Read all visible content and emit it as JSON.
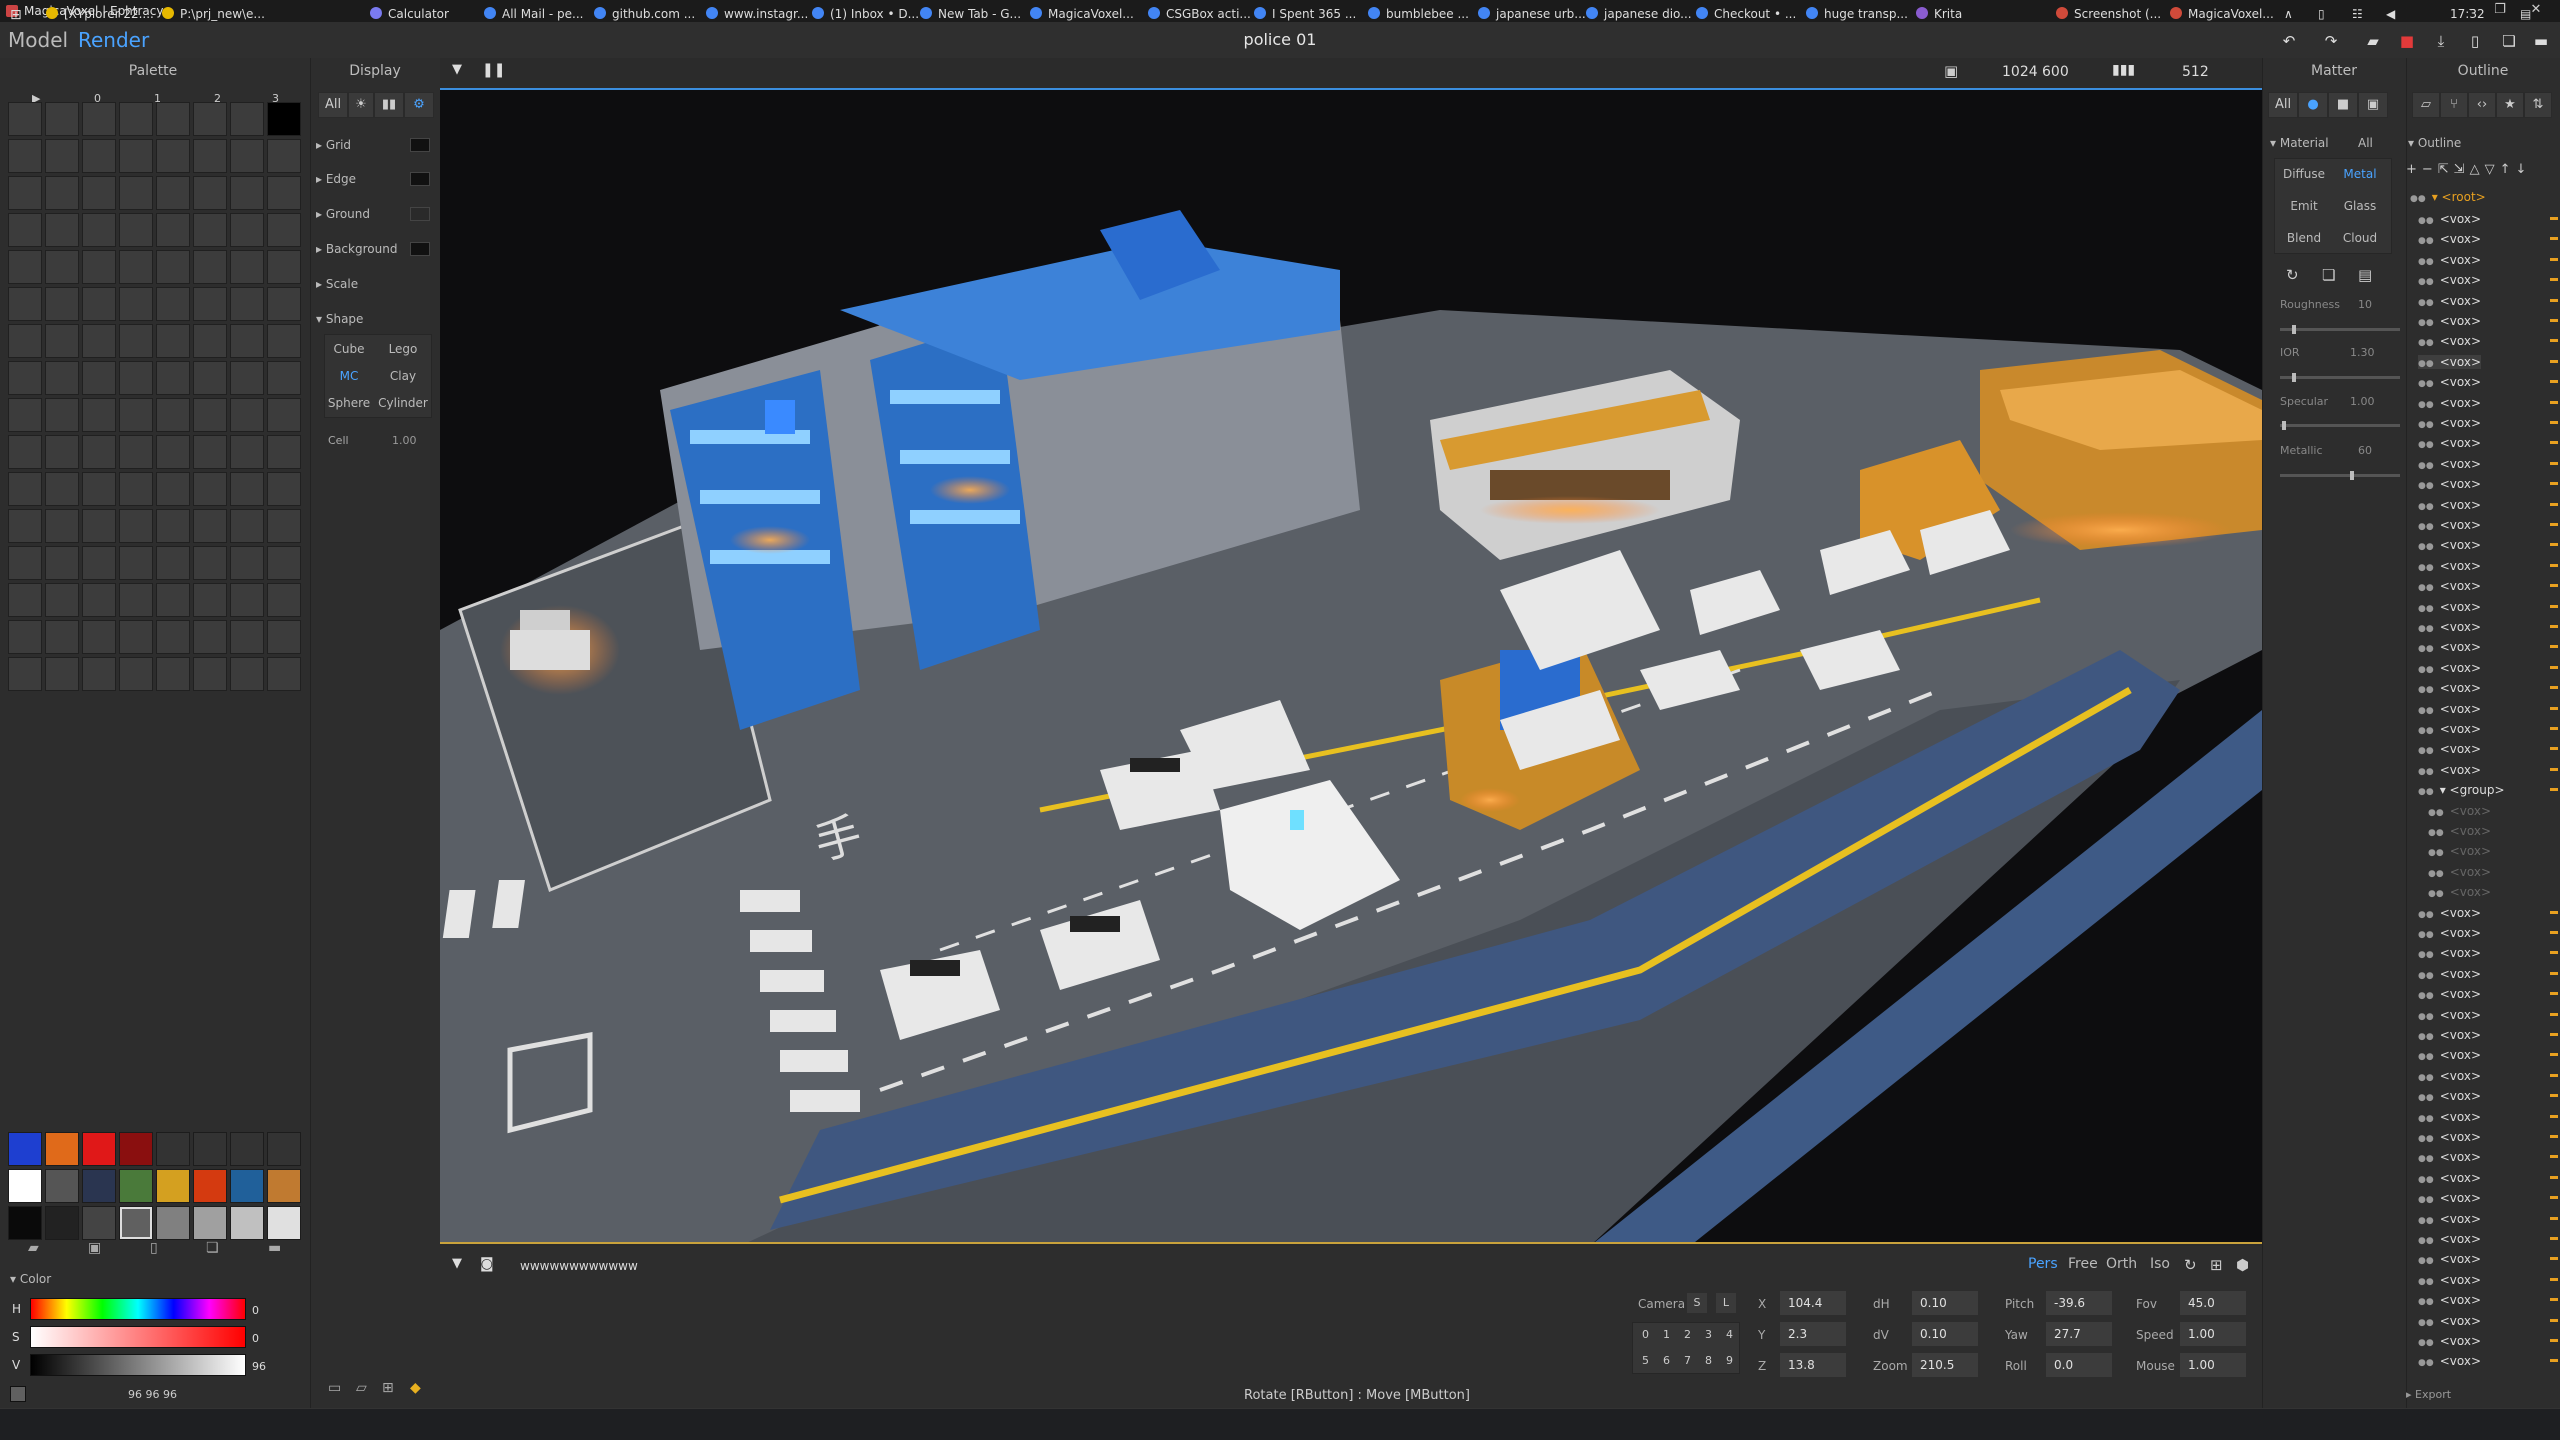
{
  "window": {
    "title": "MagicaVoxel | Ephtracy"
  },
  "menu": {
    "model": "Model",
    "render": "Render",
    "doc_name": "police 01"
  },
  "palette": {
    "title": "Palette",
    "cols": [
      "0",
      "1",
      "2",
      "3"
    ],
    "swatches": [
      "#1e3fd0",
      "#e06a1a",
      "#e01818",
      "#8a0f0f",
      "#333333",
      "#333333",
      "#333333",
      "#333333",
      "#ffffff",
      "#555555",
      "#2a3550",
      "#4a7a3a",
      "#d4a020",
      "#d43a10",
      "#20609a",
      "#c07a30",
      "#0a0a0a",
      "#222222",
      "#444444",
      "#606060",
      "#808080",
      "#a0a0a0",
      "#c0c0c0",
      "#e0e0e0"
    ],
    "color_section": "Color",
    "h": {
      "label": "H",
      "value": "0"
    },
    "s": {
      "label": "S",
      "value": "0"
    },
    "v": {
      "label": "V",
      "value": "96"
    },
    "rgb": "96  96  96"
  },
  "display": {
    "title": "Display",
    "filter_all": "All",
    "rows": [
      "Grid",
      "Edge",
      "Ground",
      "Background",
      "Scale",
      "Shape"
    ],
    "shapes": [
      "Cube",
      "Lego",
      "MC",
      "Clay",
      "Sphere",
      "Cylinder"
    ],
    "cell_label": "Cell",
    "cell_value": "1.00"
  },
  "viewport": {
    "width": "1024",
    "height": "600",
    "samples": "512"
  },
  "bottom": {
    "text_field": "wwwwwwwwwwww",
    "modes": [
      "Pers",
      "Free",
      "Orth",
      "Iso"
    ],
    "camera_label": "Camera",
    "slot_buttons": [
      "S",
      "L"
    ],
    "slots": [
      "0",
      "1",
      "2",
      "3",
      "4",
      "5",
      "6",
      "7",
      "8",
      "9"
    ],
    "fields": [
      {
        "label": "X",
        "value": "104.4"
      },
      {
        "label": "Y",
        "value": "2.3"
      },
      {
        "label": "Z",
        "value": "13.8"
      },
      {
        "label": "dH",
        "value": "0.10"
      },
      {
        "label": "dV",
        "value": "0.10"
      },
      {
        "label": "Zoom",
        "value": "210.5"
      },
      {
        "label": "Pitch",
        "value": "-39.6"
      },
      {
        "label": "Yaw",
        "value": "27.7"
      },
      {
        "label": "Roll",
        "value": "0.0"
      },
      {
        "label": "Fov",
        "value": "45.0"
      },
      {
        "label": "Speed",
        "value": "1.00"
      },
      {
        "label": "Mouse",
        "value": "1.00"
      }
    ],
    "status": "Rotate [RButton] : Move [MButton]"
  },
  "matter": {
    "title": "Matter",
    "filter_all": "All",
    "material_label": "Material",
    "material_all": "All",
    "types": [
      "Diffuse",
      "Metal",
      "Emit",
      "Glass",
      "Blend",
      "Cloud"
    ],
    "props": [
      {
        "label": "Roughness",
        "value": "10",
        "level": 0.1
      },
      {
        "label": "IOR",
        "value": "1.30",
        "level": 0.1
      },
      {
        "label": "Specular",
        "value": "1.00",
        "level": 0.02
      },
      {
        "label": "Metallic",
        "value": "60",
        "level": 0.6
      }
    ]
  },
  "outline": {
    "title": "Outline",
    "section": "Outline",
    "root": "<root>",
    "vox": "<vox>",
    "group": "<group>",
    "export": "Export"
  },
  "taskbar": {
    "items": [
      "[XYplorer 22....",
      "P:\\prj_new\\e...",
      "Calculator",
      "All Mail - pe...",
      "github.com ...",
      "www.instagr...",
      "(1) Inbox • D...",
      "New Tab - G...",
      "MagicaVoxel...",
      "CSGBox acti...",
      "I Spent 365 ...",
      "bumblebee ...",
      "japanese urb...",
      "japanese dio...",
      "Checkout • ...",
      "huge transp...",
      "Krita",
      "Screenshot (...",
      "MagicaVoxel..."
    ],
    "clock": "17:32"
  }
}
